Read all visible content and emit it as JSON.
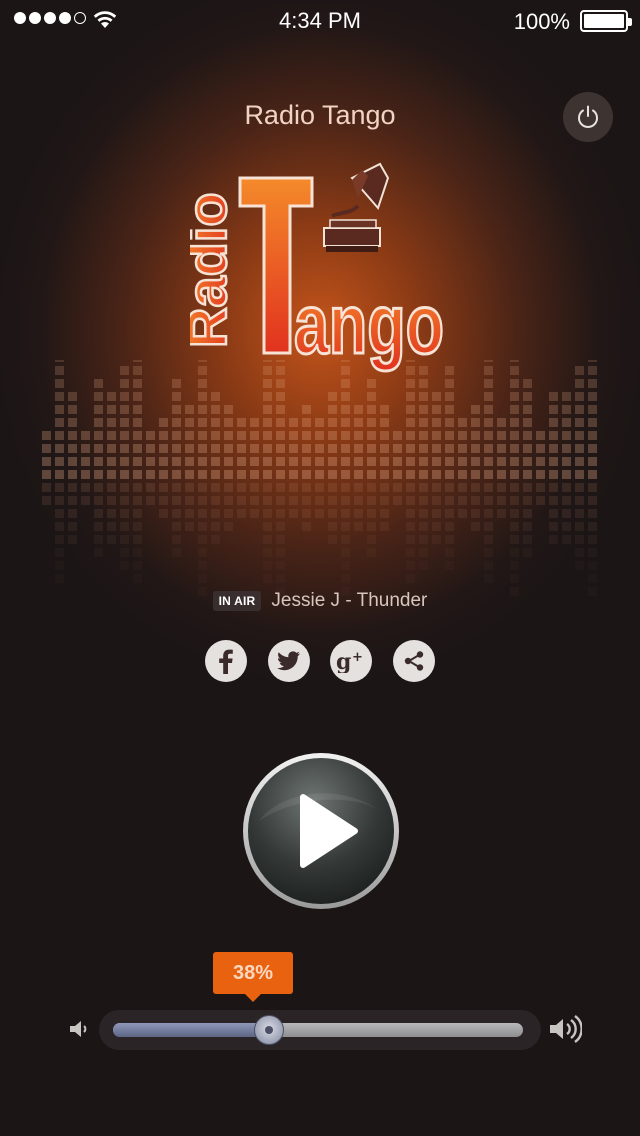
{
  "status_bar": {
    "time": "4:34 PM",
    "battery": "100%",
    "signal_bars": 4,
    "signal_total": 5
  },
  "header": {
    "title": "Radio Tango",
    "power_icon": "power-icon"
  },
  "logo": {
    "word_top": "Radio",
    "word_main": "Tango",
    "icon": "gramophone-icon"
  },
  "now_playing": {
    "badge": "IN AIR",
    "track": "Jessie J - Thunder"
  },
  "social": [
    {
      "name": "facebook",
      "icon": "facebook-icon",
      "glyph": "f"
    },
    {
      "name": "twitter",
      "icon": "twitter-icon",
      "glyph": ""
    },
    {
      "name": "google-plus",
      "icon": "google-plus-icon",
      "glyph": "g+"
    },
    {
      "name": "share",
      "icon": "share-icon",
      "glyph": ""
    }
  ],
  "player": {
    "play_icon": "play-icon"
  },
  "volume": {
    "label": "38%",
    "level": 0.38
  },
  "colors": {
    "accent": "#e8620f",
    "logo_red": "#e63a22",
    "logo_orange": "#f07a25"
  }
}
